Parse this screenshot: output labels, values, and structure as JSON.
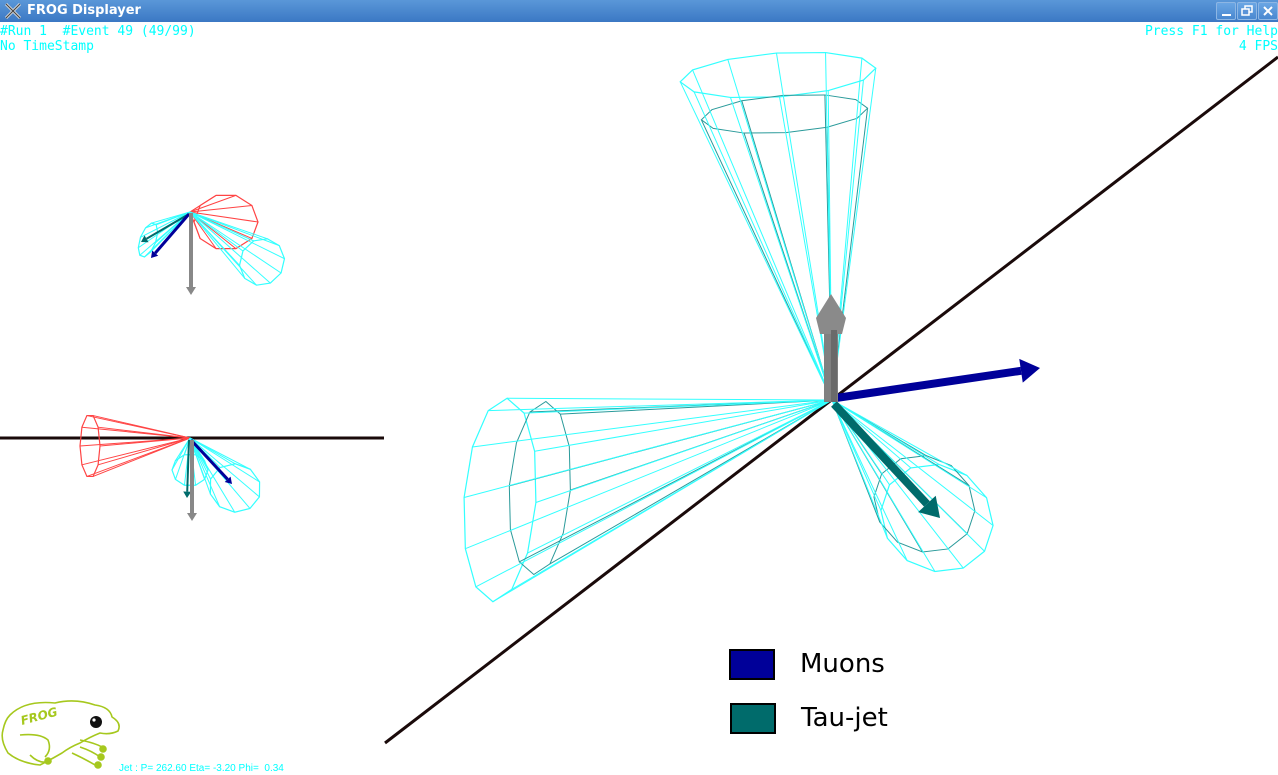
{
  "window": {
    "title": "FROG Displayer",
    "buttons": {
      "minimize": "minimize",
      "restore": "restore",
      "close": "close"
    }
  },
  "hud": {
    "run_event": "#Run 1  #Event 49 (49/99)",
    "timestamp": "No TimeStamp",
    "help": "Press F1 for Help",
    "fps": "4 FPS"
  },
  "selection_info": "Jet : P= 262.60 Eta= -3.20 Phi=  0.34",
  "logo": {
    "text": "FROG",
    "color": "#a6c81e"
  },
  "legend": [
    {
      "label": "Muons",
      "color": "#000099"
    },
    {
      "label": "Tau-jet",
      "color": "#006b6b"
    }
  ],
  "colors": {
    "jet_cone": "#33ffff",
    "jet_cone_dark": "#2a9a9a",
    "red_cone": "#ff4444",
    "beam_axis": "#1a0a0a",
    "met_arrow": "#888888",
    "muon_arrow": "#000099",
    "tau_arrow": "#006b6b",
    "hud_text": "#00ffff"
  }
}
